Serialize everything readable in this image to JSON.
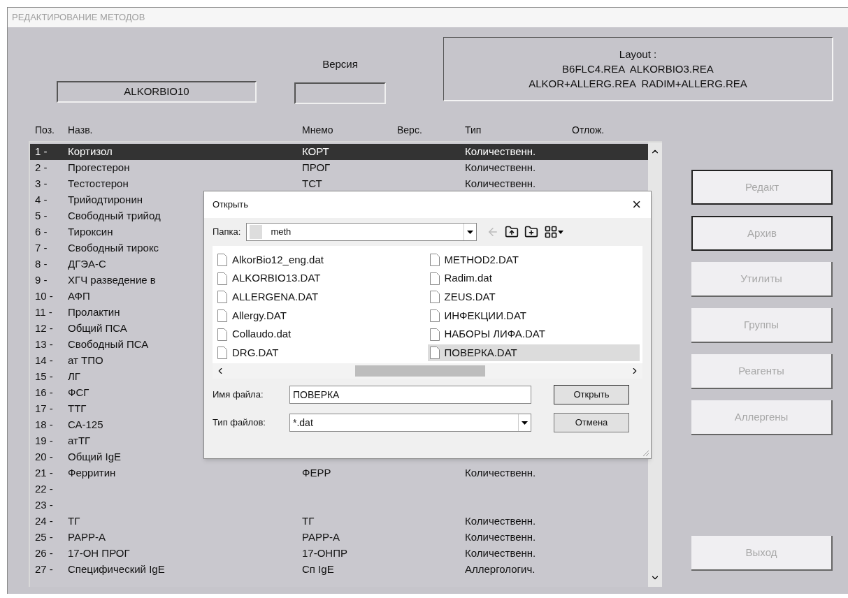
{
  "window": {
    "title": "РЕДАКТИРОВАНИЕ МЕТОДОВ"
  },
  "method": {
    "name": "ALKORBIO10",
    "version_label": "Версия"
  },
  "layout_box": {
    "lines": [
      "Layout :",
      "B6FLC4.REA  ALKORBIO3.REA",
      "ALKOR+ALLERG.REA  RADIM+ALLERG.REA"
    ]
  },
  "table": {
    "columns": [
      "Поз.",
      "Назв.",
      "Мнемо",
      "Верс.",
      "Тип",
      "Отлож."
    ],
    "rows": [
      {
        "pos": "1 -",
        "name": "Кортизол",
        "mnemo": "КОРТ",
        "type": "Количественн.",
        "selected": true
      },
      {
        "pos": "2 -",
        "name": "Прогестерон",
        "mnemo": "ПРОГ",
        "type": "Количественн.",
        "selected": false
      },
      {
        "pos": "3 -",
        "name": "Тестостерон",
        "mnemo": "ТСТ",
        "type": "Количественн.",
        "selected": false
      },
      {
        "pos": "4 -",
        "name": "Трийодтиронин",
        "selected": false
      },
      {
        "pos": "5 -",
        "name": "Свободный трийод",
        "selected": false
      },
      {
        "pos": "6 -",
        "name": "Тироксин",
        "selected": false
      },
      {
        "pos": "7 -",
        "name": "Свободный тирокс",
        "selected": false
      },
      {
        "pos": "8 -",
        "name": "ДГЭА-С",
        "selected": false
      },
      {
        "pos": "9 -",
        "name": "ХГЧ разведение в",
        "selected": false
      },
      {
        "pos": "10 -",
        "name": "АФП",
        "selected": false
      },
      {
        "pos": "11 -",
        "name": "Пролактин",
        "selected": false
      },
      {
        "pos": "12 -",
        "name": "Общий ПСА",
        "selected": false
      },
      {
        "pos": "13 -",
        "name": "Свободный ПСА",
        "selected": false
      },
      {
        "pos": "14 -",
        "name": "ат ТПО",
        "selected": false
      },
      {
        "pos": "15 -",
        "name": "ЛГ",
        "selected": false
      },
      {
        "pos": "16 -",
        "name": "ФСГ",
        "selected": false
      },
      {
        "pos": "17 -",
        "name": "ТТГ",
        "selected": false
      },
      {
        "pos": "18 -",
        "name": "СА-125",
        "selected": false
      },
      {
        "pos": "19 -",
        "name": "атТГ",
        "selected": false
      },
      {
        "pos": "20 -",
        "name": "Общий IgE",
        "selected": false
      },
      {
        "pos": "21 -",
        "name": "Ферритин",
        "mnemo": "ФЕРР",
        "type": "Количественн.",
        "selected": false
      },
      {
        "pos": "22 -",
        "selected": false
      },
      {
        "pos": "23 -",
        "selected": false
      },
      {
        "pos": "24 -",
        "name": "ТГ",
        "mnemo": "ТГ",
        "type": "Количественн.",
        "selected": false
      },
      {
        "pos": "25 -",
        "name": "PAPP-A",
        "mnemo": "PAPP-A",
        "type": "Количественн.",
        "selected": false
      },
      {
        "pos": "26 -",
        "name": "17-ОН ПРОГ",
        "mnemo": "17-ОНПР",
        "type": "Количественн.",
        "selected": false
      },
      {
        "pos": "27 -",
        "name": "Специфический IgE",
        "mnemo": "Сп IgE",
        "type": "Аллергологич.",
        "selected": false
      }
    ]
  },
  "buttons": [
    {
      "label": "Редакт",
      "disabled": true,
      "highlighted": true
    },
    {
      "label": "Архив",
      "disabled": true,
      "highlighted": true
    },
    {
      "label": "Утилиты",
      "disabled": true,
      "highlighted": false
    },
    {
      "label": "Группы",
      "disabled": true,
      "highlighted": false
    },
    {
      "label": "Реагенты",
      "disabled": true,
      "highlighted": false
    },
    {
      "label": "Аллергены",
      "disabled": true,
      "highlighted": false
    }
  ],
  "exit_button": {
    "label": "Выход",
    "disabled": true
  },
  "dialog": {
    "title": "Открыть",
    "close": "×",
    "folder_label": "Папка:",
    "folder": "meth",
    "files": [
      {
        "name": "AlkorBio12_eng.dat",
        "selected": false
      },
      {
        "name": "ALKORBIO13.DAT",
        "selected": false
      },
      {
        "name": "ALLERGENA.DAT",
        "selected": false
      },
      {
        "name": "Allergy.DAT",
        "selected": false
      },
      {
        "name": "Collaudo.dat",
        "selected": false
      },
      {
        "name": "DRG.DAT",
        "selected": false
      },
      {
        "name": "METHOD2.DAT",
        "selected": false
      },
      {
        "name": "Radim.dat",
        "selected": false
      },
      {
        "name": "ZEUS.DAT",
        "selected": false
      },
      {
        "name": "ИНФЕКЦИИ.DAT",
        "selected": false
      },
      {
        "name": "НАБОРЫ ЛИФА.DAT",
        "selected": false
      },
      {
        "name": "ПОВЕРКА.DAT",
        "selected": true
      }
    ],
    "filename_label": "Имя файла:",
    "filename": "ПОВЕРКА",
    "filetype_label": "Тип файлов:",
    "filetype": "*.dat",
    "open_button": "Открыть",
    "cancel_button": "Отмена"
  }
}
